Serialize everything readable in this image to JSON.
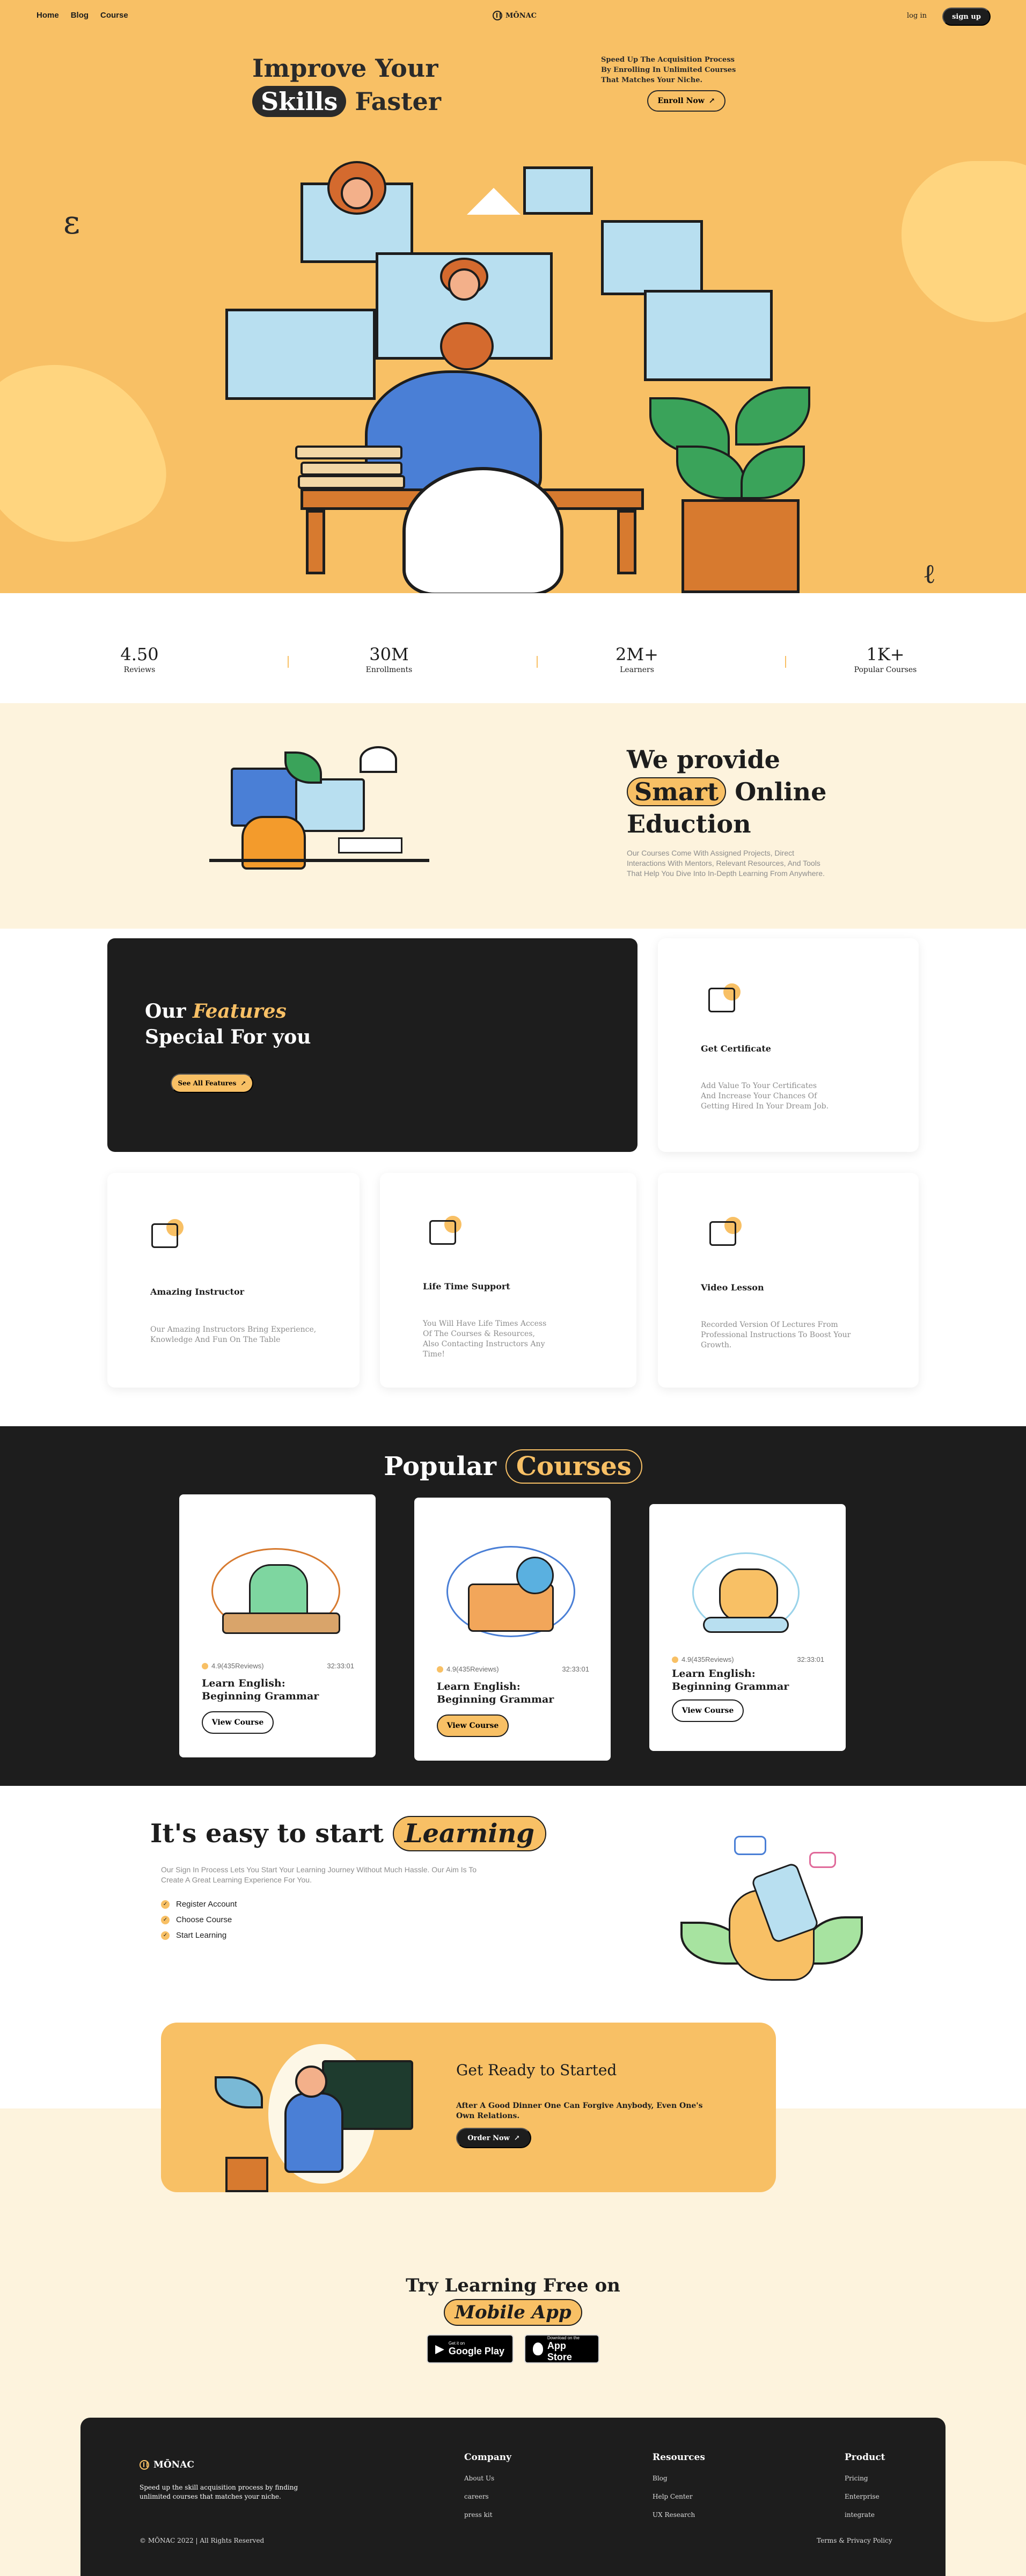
{
  "nav": {
    "links": [
      "Home",
      "Blog",
      "Course"
    ],
    "brand": "MŌNAC",
    "login": "log in",
    "signup": "sign up"
  },
  "hero": {
    "title_line1": "Improve Your",
    "title_highlight": "Skills",
    "title_line2_rest": " Faster",
    "subtitle": "Speed Up The Acquisition Process By Enrolling In Unlimited Courses That Matches Your Niche.",
    "enroll_label": "Enroll Now",
    "arrow": "↗"
  },
  "stats": [
    {
      "value": "4.50",
      "label": "Reviews"
    },
    {
      "value": "30M",
      "label": "Enrollments"
    },
    {
      "value": "2M+",
      "label": "Learners"
    },
    {
      "value": "1K+",
      "label": "Popular Courses"
    }
  ],
  "provide": {
    "line1": "We provide",
    "highlight": "Smart",
    "line2_rest": " Online",
    "line3": "Eduction",
    "text": "Our Courses Come With Assigned Projects, Direct Interactions With Mentors, Relevant Resources, And Tools That Help You Dive Into In-Depth Learning From Anywhere."
  },
  "features": {
    "title_our": "Our ",
    "title_highlight": "Features",
    "title_line2": "Special For you",
    "see_all": "See All Features",
    "items": [
      {
        "title": "Get Certificate",
        "text": "Add Value To Your Certificates And Increase Your Chances Of Getting Hired In Your Dream Job."
      },
      {
        "title": "Amazing Instructor",
        "text": "Our Amazing Instructors Bring Experience, Knowledge And Fun On The Table"
      },
      {
        "title": "Life Time Support",
        "text": "You Will Have Life Times Access Of The Courses & Resources, Also Contacting Instructors Any Time!"
      },
      {
        "title": "Video Lesson",
        "text": "Recorded Version Of Lectures From Professional Instructions To Boost Your Growth."
      }
    ]
  },
  "popular": {
    "title": "Popular ",
    "highlight": "Courses",
    "courses": [
      {
        "rating": "4.9(435Reviews)",
        "time": "32:33:01",
        "title": "Learn English: Beginning Grammar",
        "button": "View Course"
      },
      {
        "rating": "4.9(435Reviews)",
        "time": "32:33:01",
        "title": "Learn English: Beginning Grammar",
        "button": "View Course"
      },
      {
        "rating": "4.9(435Reviews)",
        "time": "32:33:01",
        "title": "Learn English: Beginning Grammar",
        "button": "View Course"
      }
    ]
  },
  "easy": {
    "title": "It's easy to start ",
    "highlight": "Learning",
    "text": "Our Sign In Process Lets You Start Your Learning Journey Without Much Hassle. Our Aim Is To Create A Great Learning Experience For You.",
    "steps": [
      "Register Account",
      "Choose Course",
      "Start Learning"
    ]
  },
  "cta": {
    "title": "Get Ready to Started",
    "text": "After A Good Dinner One Can Forgive Anybody, Even One's Own Relations.",
    "button": "Order Now"
  },
  "mobile": {
    "title": "Try Learning Free on",
    "highlight": "Mobile App",
    "google_small": "Get it on",
    "google_big": "Google Play",
    "apple_small": "Download on the",
    "apple_big": "App Store"
  },
  "footer": {
    "brand": "MŌNAC",
    "desc": "Speed up the skill acquisition process by finding unlimited courses that matches your niche.",
    "columns": [
      {
        "title": "Company",
        "links": [
          "About Us",
          "careers",
          "press kit"
        ]
      },
      {
        "title": "Resources",
        "links": [
          "Blog",
          "Help Center",
          "UX Research"
        ]
      },
      {
        "title": "Product",
        "links": [
          "Pricing",
          "Enterprise",
          "integrate"
        ]
      }
    ],
    "copyright": "© MŌNAC 2022 | All Rights Reserved",
    "terms": "Terms & Privacy Policy"
  },
  "colors": {
    "accent": "#f8c065",
    "dark": "#1d1d1d",
    "cream": "#fdf3dd"
  }
}
